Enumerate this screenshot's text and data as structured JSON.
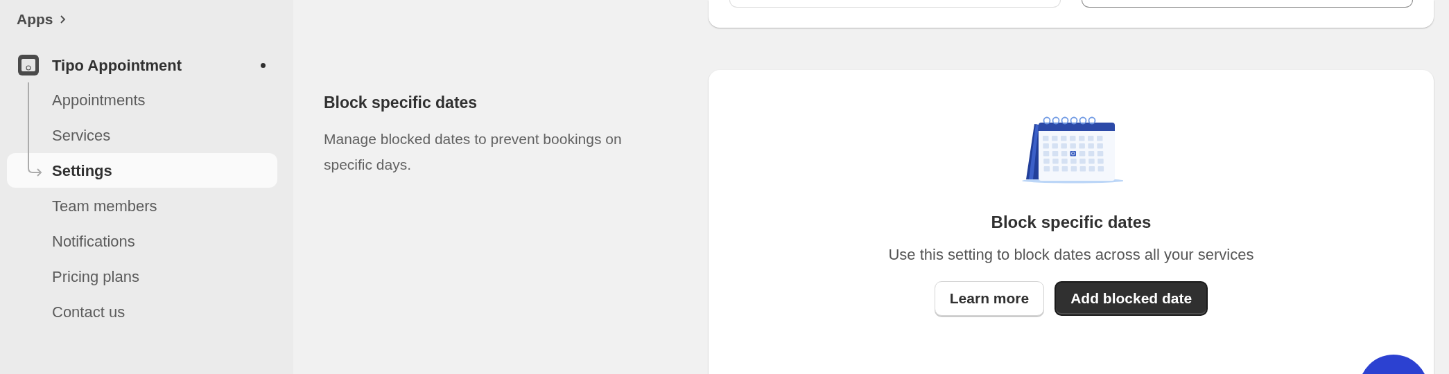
{
  "sidebar": {
    "breadcrumb": "Apps",
    "app": {
      "name": "Tipo Appointment",
      "has_unread_dot": true
    },
    "items": [
      {
        "label": "Appointments",
        "selected": false
      },
      {
        "label": "Services",
        "selected": false
      },
      {
        "label": "Settings",
        "selected": true
      },
      {
        "label": "Team members",
        "selected": false
      },
      {
        "label": "Notifications",
        "selected": false
      },
      {
        "label": "Pricing plans",
        "selected": false
      },
      {
        "label": "Contact us",
        "selected": false
      }
    ]
  },
  "section": {
    "title": "Block specific dates",
    "description": "Manage blocked dates to prevent bookings on specific days.",
    "card": {
      "title": "Block specific dates",
      "text": "Use this setting to block dates across all your services",
      "buttons": [
        {
          "label": "Learn more",
          "kind": "secondary"
        },
        {
          "label": "Add blocked date",
          "kind": "primary"
        }
      ]
    }
  }
}
